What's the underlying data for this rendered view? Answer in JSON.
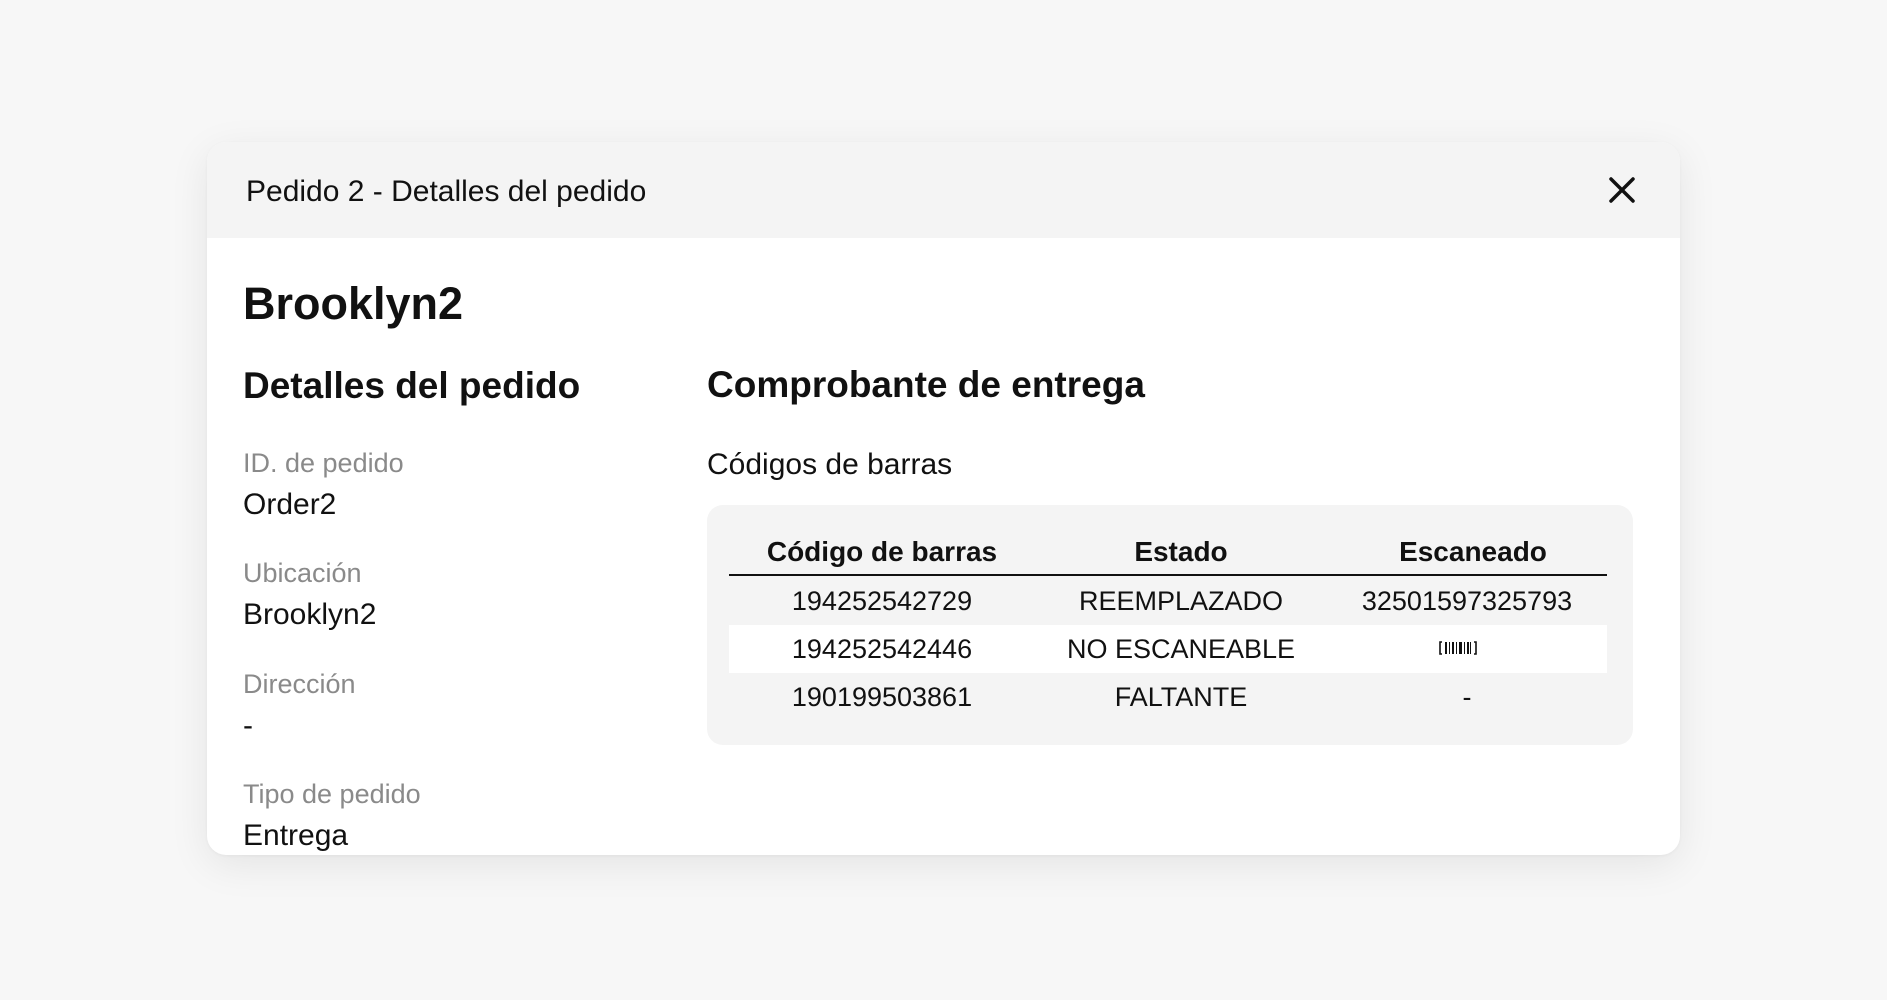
{
  "modal": {
    "title": "Pedido 2 - Detalles del pedido",
    "close_icon": "close-icon"
  },
  "store_name": "Brooklyn2",
  "order_details": {
    "section_title": "Detalles del pedido",
    "fields": [
      {
        "label": "ID. de pedido",
        "value": "Order2"
      },
      {
        "label": "Ubicación",
        "value": "Brooklyn2"
      },
      {
        "label": "Dirección",
        "value": "-"
      },
      {
        "label": "Tipo de pedido",
        "value": "Entrega"
      }
    ]
  },
  "proof_of_delivery": {
    "section_title": "Comprobante de entrega",
    "barcodes_label": "Códigos de barras",
    "table": {
      "headers": [
        "Código de barras",
        "Estado",
        "Escaneado"
      ],
      "rows": [
        {
          "barcode": "194252542729",
          "status": "REEMPLAZADO",
          "scanned": "32501597325793"
        },
        {
          "barcode": "194252542446",
          "status": "NO ESCANEABLE",
          "scanned_icon": "barcode-icon"
        },
        {
          "barcode": "190199503861",
          "status": "FALTANTE",
          "scanned": "-"
        }
      ]
    }
  },
  "colors": {
    "page_background": "#f7f7f7",
    "header_background": "#f4f4f4",
    "table_background": "#f4f4f4",
    "label_gray": "#8a8a8a",
    "text": "#111111"
  }
}
